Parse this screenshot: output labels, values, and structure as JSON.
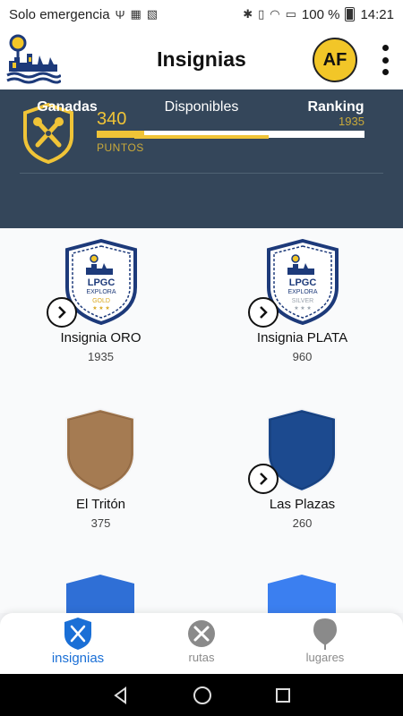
{
  "status": {
    "carrier": "Solo emergencia",
    "battery": "100 %",
    "time": "14:21"
  },
  "header": {
    "title": "Insignias",
    "avatar_initials": "AF"
  },
  "summary": {
    "points": "340",
    "points_max": "1935",
    "points_label": "PUNTOS",
    "progress_fraction": 0.176
  },
  "tabs": [
    {
      "label": "Ganadas"
    },
    {
      "label": "Disponibles",
      "active": true
    },
    {
      "label": "Ranking"
    }
  ],
  "badges": [
    {
      "name": "Insignia ORO",
      "points": "1935",
      "type": "crest",
      "tier": "GOLD",
      "crest_title": "LPGC",
      "crest_sub": "EXPLORA",
      "has_arrow": true
    },
    {
      "name": "Insignia PLATA",
      "points": "960",
      "type": "crest",
      "tier": "SILVER",
      "crest_title": "LPGC",
      "crest_sub": "EXPLORA",
      "has_arrow": true
    },
    {
      "name": "El Tritón",
      "points": "375",
      "type": "plain",
      "color": "#a57b52",
      "has_arrow": false
    },
    {
      "name": "Las Plazas",
      "points": "260",
      "type": "plain",
      "color": "#1c4a8f",
      "has_arrow": true
    },
    {
      "name": "",
      "points": "",
      "type": "plain",
      "color": "#2f6fd6",
      "has_arrow": false
    },
    {
      "name": "",
      "points": "",
      "type": "plain",
      "color": "#3b7ff0",
      "has_arrow": false
    }
  ],
  "bottom_nav": [
    {
      "label": "insignias",
      "icon": "shield-icon",
      "active": true
    },
    {
      "label": "rutas",
      "icon": "tools-icon",
      "active": false
    },
    {
      "label": "lugares",
      "icon": "map-pin-icon",
      "active": false
    }
  ],
  "colors": {
    "accent": "#f0c437",
    "hero_bg": "#34465a",
    "active_nav": "#1a6fd6",
    "inactive_nav": "#8a8a8a"
  }
}
